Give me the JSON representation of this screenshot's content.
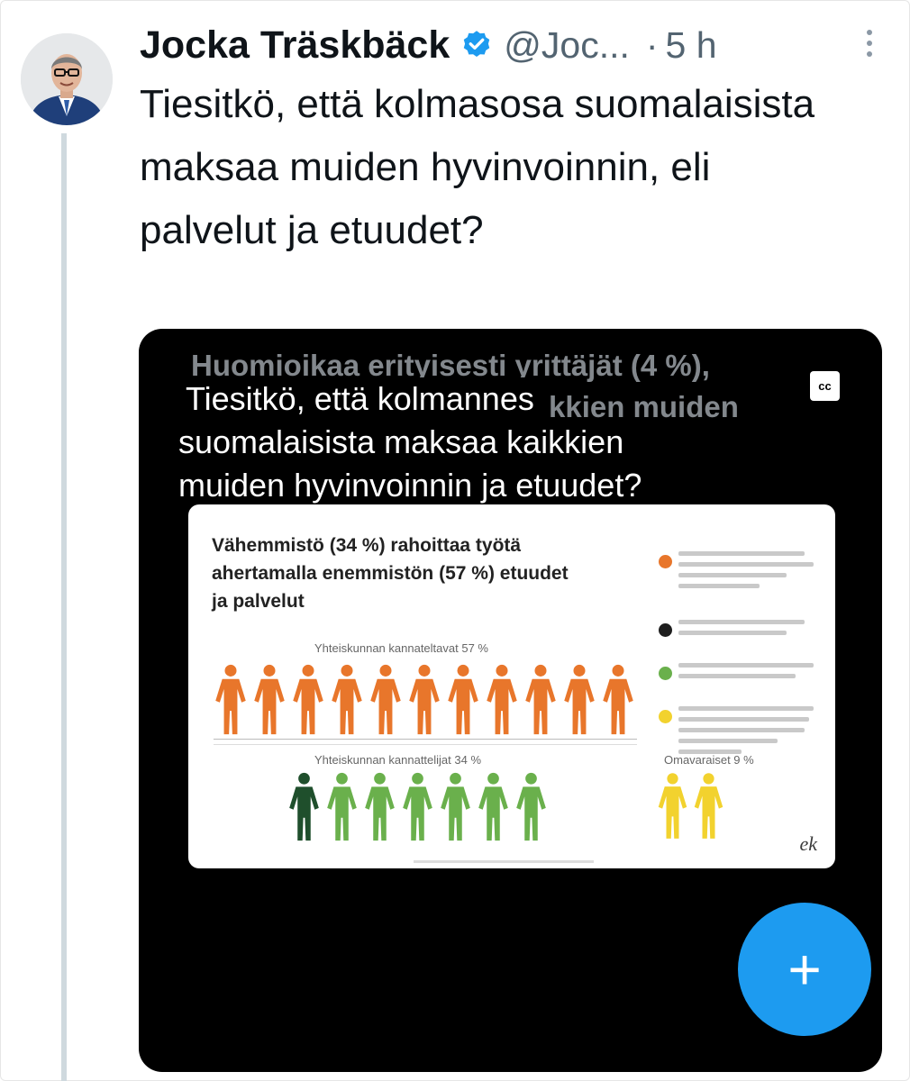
{
  "tweet": {
    "author": {
      "display_name": "Jocka Träskbäck",
      "handle": "@Joc...",
      "verified": true
    },
    "separator": "·",
    "time": "5 h",
    "text": "Tiesitkö, että kolmasosa suomalaisista maksaa muiden hyvinvoinnin, eli palvelut ja etuudet?",
    "more_icon": "more-vertical-icon"
  },
  "video": {
    "background_text": {
      "line1": "Huomioikaa erityisesti yrittäjät (4 %),",
      "line2": "kkien muiden"
    },
    "caption": {
      "line1": "Tiesitkö, että kolmannes",
      "line2": "suomalaisista maksaa kaikkien",
      "line3": "muiden hyvinvoinnin ja etuudet?"
    },
    "cc_label": "cc",
    "infographic": {
      "title": "Vähemmistö (34 %) rahoittaa työtä ahertamalla enemmistön (57 %) etuudet ja palvelut",
      "group_supported_label": "Yhteiskunnan kannateltavat 57 %",
      "group_supporters_label": "Yhteiskunnan kannattelijat 34 %",
      "group_self_label": "Omavaraiset 9 %",
      "logo": "ek",
      "colors": {
        "orange": "#e8762b",
        "black": "#1e1e1e",
        "dark_green": "#1f4f2c",
        "green": "#6ab04c",
        "yellow": "#f2d22e"
      }
    },
    "bottom_partial_text": "..."
  },
  "fab": {
    "label": "+",
    "icon": "compose-plus-icon",
    "color": "#1d9bf0"
  }
}
